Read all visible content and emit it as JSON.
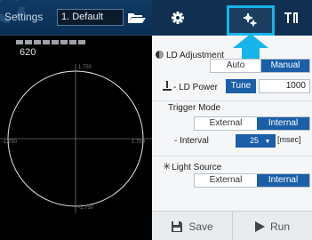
{
  "header": {
    "settings_label": "Settings",
    "preset_value": "1. Default"
  },
  "readout": {
    "value": "620"
  },
  "scope": {
    "top_label": "1.750",
    "bottom_label": "-1.750",
    "left_label": "-1.750",
    "right_label": "1.750"
  },
  "tabs": [
    {
      "icon": "gear-icon"
    },
    {
      "icon": "tools-icon",
      "active": true
    },
    {
      "icon": "antenna-icon"
    }
  ],
  "ld_adjustment": {
    "title": "LD Adjustment",
    "options": [
      "Auto",
      "Manual"
    ],
    "selected": "Manual"
  },
  "ld_power": {
    "label": "- LD Power",
    "tune_label": "Tune",
    "value": "1000"
  },
  "trigger_mode": {
    "title": "Trigger Mode",
    "options": [
      "External",
      "Internal"
    ],
    "selected": "Internal",
    "interval_label": "- Interval",
    "interval_value": "25",
    "interval_unit": "[msec]"
  },
  "light_source": {
    "title": "Light Source",
    "options": [
      "External",
      "Internal"
    ],
    "selected": "Internal"
  },
  "footer": {
    "save_label": "Save",
    "run_label": "Run"
  },
  "colors": {
    "accent": "#1a5fa8",
    "highlight": "#16b4e8",
    "header_bg": "#102f51"
  }
}
